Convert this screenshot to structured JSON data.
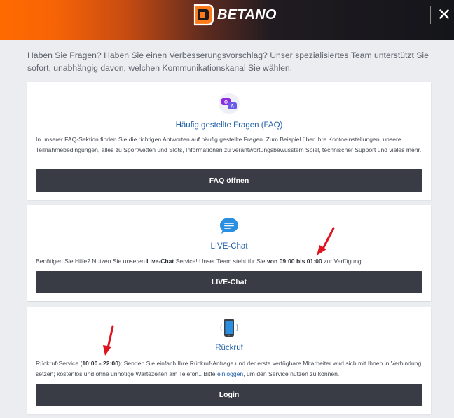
{
  "header": {
    "brand": "BETANO",
    "close_icon": "close-icon"
  },
  "intro": "Haben Sie Fragen? Haben Sie einen Verbesserungsvorschlag? Unser spezialisiertes Team unterstützt Sie sofort, unabhängig davon, welchen Kommunikationskanal Sie wählen.",
  "faq": {
    "icon": "faq-bubbles-icon",
    "title": "Häufig gestellte Fragen (FAQ)",
    "text": "In unserer FAQ-Sektion finden Sie die richtigen Antworten auf häufig gestellte Fragen. Zum Beispiel über Ihre Kontoeinstellungen, unsere Teilnahmebedingungen, alles zu Sportwetten und Slots, Informationen zu verantwortungsbewusstem Spiel, technischer Support und vieles mehr.",
    "button": "FAQ öffnen"
  },
  "chat": {
    "icon": "chat-bubble-icon",
    "title": "LIVE-Chat",
    "text_before": "Benötigen Sie Hilfe? Nutzen Sie unseren ",
    "text_bold1": "Live-Chat",
    "text_middle": " Service! Unser Team steht für Sie ",
    "text_bold2": "von 09:00 bis 01:00",
    "text_after": " zur Verfügung.",
    "button": "LIVE-Chat"
  },
  "callback": {
    "icon": "phone-icon",
    "title": "Rückruf",
    "text_before": "Rückruf-Service (",
    "text_bold": "10:00 - 22:00",
    "text_middle": "): Senden Sie einfach Ihre Rückruf-Anfrage und der erste verfügbare Mitarbeiter wird sich mit Ihnen in Verbindung setzen; kostenlos und ohne unnötige Wartezeiten am Telefon.. Bitte ",
    "text_link": "einloggen",
    "text_after": ", um den Service nutzen zu können.",
    "button": "Login"
  },
  "colors": {
    "brand_orange": "#ff6a00",
    "button_dark": "#393c45",
    "link_blue": "#1f5fa8",
    "annotation_red": "#e0141e"
  }
}
